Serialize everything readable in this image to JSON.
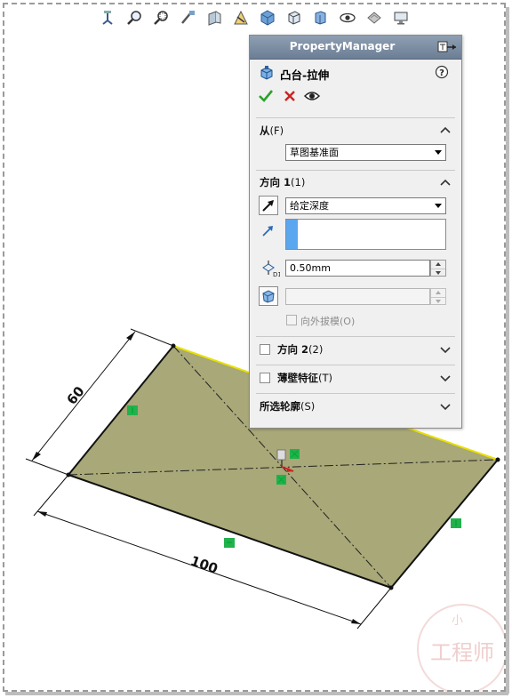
{
  "toolbar": {
    "icons": [
      "view-orientation-icon",
      "zoom-to-fit-icon",
      "zoom-area-icon",
      "previous-view-icon",
      "section-view-icon",
      "dynamic-annotation-icon",
      "display-style-icon",
      "view-type-icon",
      "hide-show-icon",
      "edit-appearance-icon",
      "apply-scene-icon",
      "view-settings-icon"
    ]
  },
  "property_manager": {
    "title": "PropertyManager",
    "feature_title": "凸台-拉伸",
    "sections": {
      "from": {
        "title": "从",
        "shortcut": "(F)",
        "value": "草图基准面"
      },
      "direction1": {
        "title": "方向 1",
        "shortcut": "(1)",
        "end_condition": "给定深度",
        "depth_value": "0.50mm",
        "draft_outward_label": "向外拔模(O)"
      },
      "direction2": {
        "title": "方向 2",
        "shortcut": "(2)"
      },
      "thin_feature": {
        "title": "薄壁特征",
        "shortcut": "(T)"
      },
      "selected_contours": {
        "title": "所选轮廓",
        "shortcut": "(S)"
      }
    }
  },
  "sketch": {
    "dimensions": {
      "height": "60",
      "width": "100"
    }
  },
  "watermark": {
    "top_text": "小",
    "main_text": "工程师"
  },
  "colors": {
    "sketch_fill": "#a8a878",
    "relation_marker": "#22b14c",
    "header": "#7d8ea3",
    "ok_green": "#2aa12a",
    "cancel_red": "#cc2222",
    "selection_blue": "#5aa6ef"
  }
}
